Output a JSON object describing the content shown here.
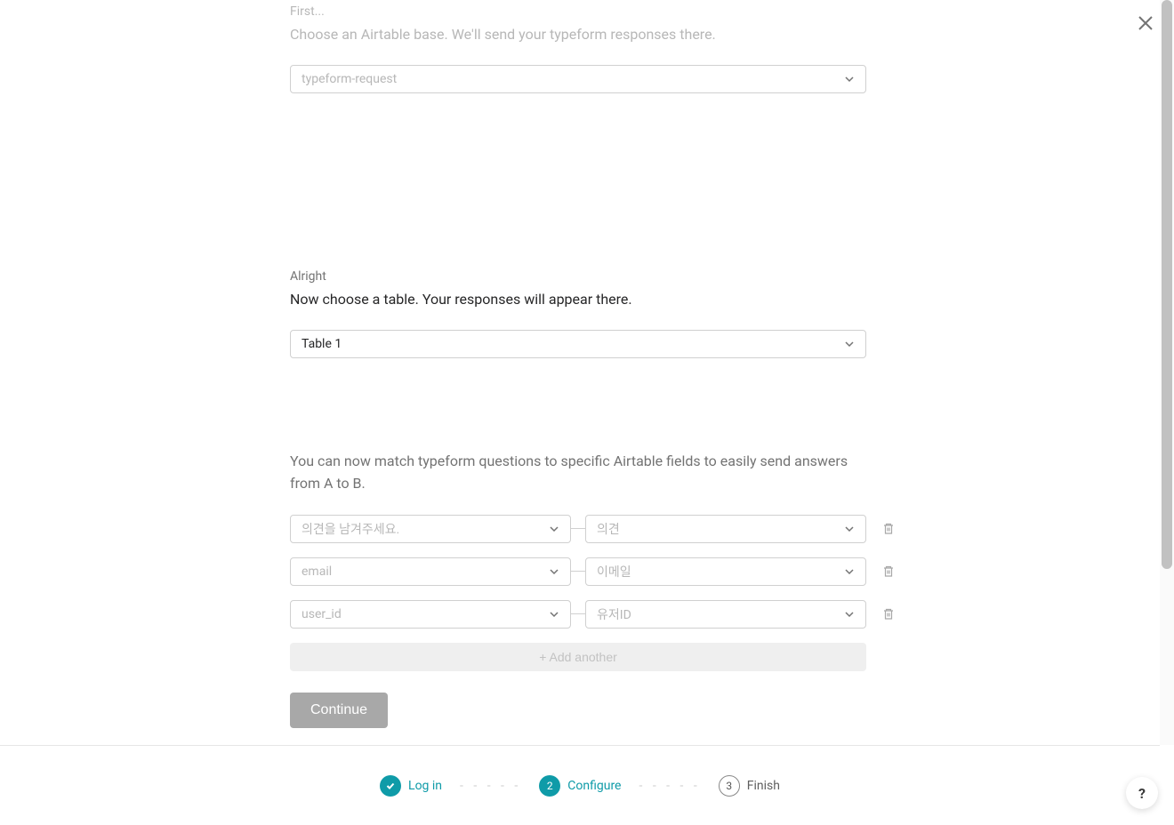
{
  "close_label": "Close",
  "section1": {
    "pre": "First...",
    "title": "Choose an Airtable base. We'll send your typeform responses there.",
    "selected": "typeform-request"
  },
  "section2": {
    "pre": "Alright",
    "title": "Now choose a table. Your responses will appear there.",
    "selected": "Table 1"
  },
  "section3": {
    "desc": "You can now match typeform questions to specific Airtable fields to easily send answers from A to B.",
    "rows": [
      {
        "left": "의견을 남겨주세요.",
        "right": "의견"
      },
      {
        "left": "email",
        "right": "이메일"
      },
      {
        "left": "user_id",
        "right": "유저ID"
      }
    ],
    "add_another": "+ Add another",
    "continue": "Continue"
  },
  "stepper": {
    "step1": {
      "label": "Log in"
    },
    "step2": {
      "number": "2",
      "label": "Configure"
    },
    "step3": {
      "number": "3",
      "label": "Finish"
    }
  },
  "help": "?"
}
